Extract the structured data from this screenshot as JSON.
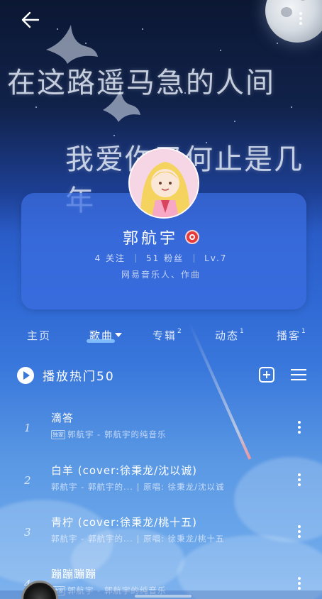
{
  "header": {
    "back_icon": "arrow-left-icon",
    "more_icon": "more-vertical-icon"
  },
  "banner": {
    "line1": "在这路遥马急的人间",
    "line2": "我爱你又何止是几年"
  },
  "profile": {
    "name": "郭航宇",
    "badge_icon": "netease-musician-badge-icon",
    "following": "4 关注",
    "followers": "51 粉丝",
    "level": "Lv.7",
    "description": "网易音乐人、作曲"
  },
  "tabs": [
    {
      "label": "主页",
      "count": ""
    },
    {
      "label": "歌曲",
      "count": ""
    },
    {
      "label": "专辑",
      "count": "2"
    },
    {
      "label": "动态",
      "count": "1"
    },
    {
      "label": "播客",
      "count": "1"
    }
  ],
  "playlist": {
    "play_label": "播放热门50",
    "add_icon": "add-to-playlist-icon",
    "list_icon": "multi-select-list-icon"
  },
  "songs": [
    {
      "num": "1",
      "title": "滴答",
      "tag": "独家",
      "sub": "郭航宇 - 郭航宇的纯音乐"
    },
    {
      "num": "2",
      "title": "白羊 (cover:徐秉龙/沈以诚)",
      "tag": "",
      "sub": "郭航宇 - 郭航宇的... | 原唱: 徐秉龙/沈以诚"
    },
    {
      "num": "3",
      "title": "青柠 (cover:徐秉龙/桃十五)",
      "tag": "",
      "sub": "郭航宇 - 郭航宇的... | 原唱: 徐秉龙/桃十五"
    },
    {
      "num": "4",
      "title": "蹦蹦蹦蹦",
      "tag": "独家",
      "sub": "郭航宇 - 郭航宇的纯音乐"
    }
  ],
  "colors": {
    "accent_red": "#e63b3b",
    "card_blue": "#3c6ee1",
    "tab_underline": "#8cc8ff"
  }
}
